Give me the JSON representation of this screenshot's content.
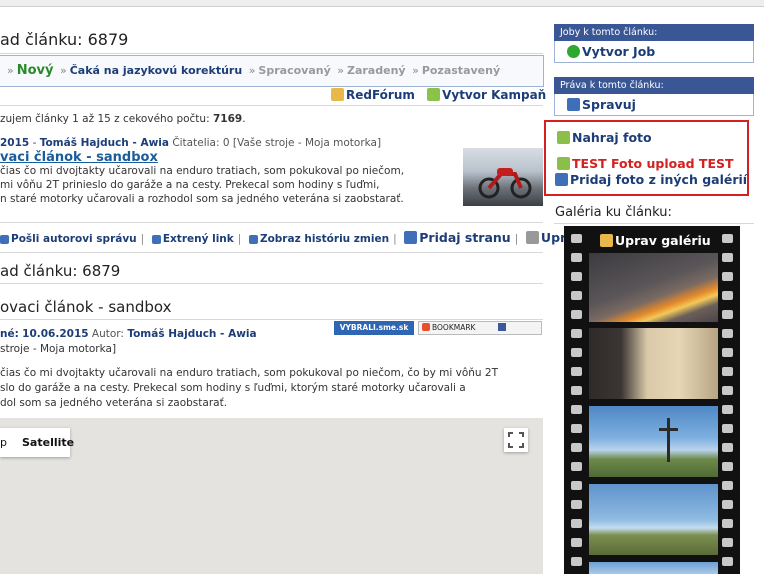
{
  "article": {
    "heading": "ad článku: 6879",
    "workflow": {
      "arrow": "»",
      "new": "Nový",
      "waiting": "Čaká na jazykovú korektúru",
      "processed": "Spracovaný",
      "assigned": "Zaradený",
      "paused": "Pozastavený"
    },
    "actions": {
      "redforum": "RedFórum",
      "campaign": "Vytvor Kampaň"
    },
    "count": {
      "prefix": "zujem články 1 až 15 z cekového počtu:",
      "total": "7169",
      "end": "."
    },
    "meta": {
      "date": "2015",
      "dash": " - ",
      "author": "Tomáš Hajduch - Awia",
      "readers": "Čitatelia: 0",
      "tags": "[Vaše stroje - Moja motorka]"
    },
    "title": "vaci článok - sandbox",
    "perex": [
      "čias čo mi dvojtakty učarovali na enduro tratiach, som pokukoval po niečom,",
      "mi vôňu 2T prinieslo do garáže a na cesty. Prekecal som hodiny s ľuďmi,",
      "n staré motorky učarovali a rozhodol som sa jedného veterána si zaobstarať."
    ],
    "tools": {
      "message": "Pošli autorovi správu",
      "external": "Extrený link",
      "history": "Zobraz históriu zmien",
      "add_page": "Pridaj stranu",
      "edit": "Uprav"
    },
    "preview": {
      "heading": "ad článku: 6879",
      "title": "ovaci článok - sandbox",
      "date_label": "né:",
      "date": "10.06.2015",
      "author_label": "Autor:",
      "author": "Tomáš Hajduch - Awia",
      "tags": "stroje - Moja motorka]",
      "vybrali": "VYBRALI.sme.sk",
      "bookmark": "BOOKMARK",
      "body": [
        "čias čo mi dvojtakty učarovali na enduro tratiach, som pokukoval po niečom, čo by mi vôňu 2T",
        "slo do garáže a na cesty. Prekecal som hodiny s ľuďmi, ktorým staré motorky učarovali a",
        "dol som sa jedného veterána si zaobstarať."
      ]
    },
    "map": {
      "type_left": "p",
      "satellite": "Satellite"
    }
  },
  "sidebar": {
    "jobs": {
      "title": "Joby k tomto článku:",
      "create": "Vytvor Job"
    },
    "rights": {
      "title": "Práva k tomto článku:",
      "manage": "Spravuj"
    },
    "photos": {
      "upload": "Nahraj foto",
      "test_upload": "TEST Foto upload TEST",
      "from_other": "Pridaj foto z iných galérií"
    },
    "gallery": {
      "title": "Galéria ku článku:",
      "edit": "Uprav galériu"
    }
  },
  "colors": {
    "navy": "#1c3d78",
    "header_bg": "#3a5795",
    "highlight_red": "#d32020",
    "new_green": "#2a8a2a"
  },
  "icons": [
    "redforum-icon",
    "campaign-icon",
    "message-icon",
    "link-icon",
    "history-icon",
    "add-page-icon",
    "edit-icon",
    "check-icon",
    "plus-icon",
    "upload-photo-icon",
    "fullscreen-icon",
    "gallery-edit-icon"
  ]
}
